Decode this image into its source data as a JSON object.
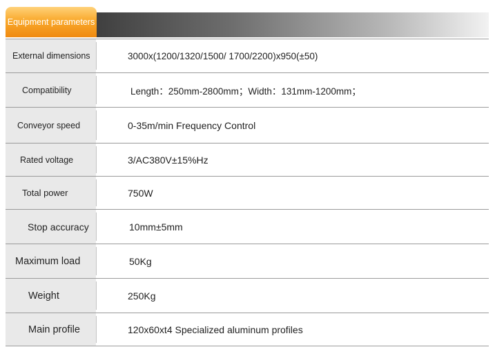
{
  "header": {
    "title": "Equipment parameters"
  },
  "rows": [
    {
      "label": "External dimensions",
      "value": "3000x(1200/1320/1500/ 1700/2200)x950(±50)"
    },
    {
      "label": "Compatibility",
      "value": "Length：250mm-2800mm；Width：131mm-1200mm；"
    },
    {
      "label": "Conveyor speed",
      "value": "0-35m/min Frequency Control"
    },
    {
      "label": "Rated voltage",
      "value": "3/AC380V±15%Hz"
    },
    {
      "label": "Total power",
      "value": "750W"
    },
    {
      "label": "Stop accuracy",
      "value": "10mm±5mm"
    },
    {
      "label": "Maximum load",
      "value": "50Kg"
    },
    {
      "label": "Weight",
      "value": "250Kg"
    },
    {
      "label": "Main profile",
      "value": "120x60xt4  Specialized aluminum profiles"
    }
  ]
}
